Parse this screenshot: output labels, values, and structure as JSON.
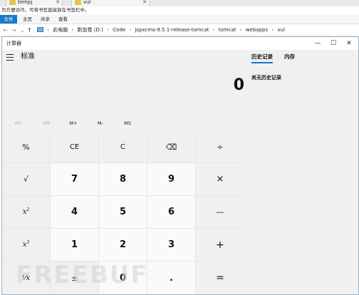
{
  "browser_tabs": [
    {
      "label": "tempj"
    },
    {
      "label": "vul"
    }
  ],
  "bookmark_bar": {
    "text": "为方便访问，可将书签直接放在书签栏中。"
  },
  "ribbon": {
    "file": "文件",
    "tabs": [
      "主页",
      "共享",
      "查看"
    ]
  },
  "address_bar": {
    "nav": {
      "back": "←",
      "forward": "→",
      "recent": "⌄",
      "up": "↑"
    },
    "breadcrumbs": [
      "此电脑",
      "新加卷 (D:)",
      "Code",
      "jspxcms-9.5.1-release-tomcat",
      "tomcat",
      "webapps",
      "vul"
    ],
    "separator": "›"
  },
  "calculator": {
    "title": "计算器",
    "window_controls": {
      "minimize": "—",
      "maximize": "☐",
      "close": "✕"
    },
    "mode": "标准",
    "display_value": "0",
    "memory": [
      {
        "label": "MC",
        "enabled": false
      },
      {
        "label": "MR",
        "enabled": false
      },
      {
        "label": "M+",
        "enabled": true
      },
      {
        "label": "M-",
        "enabled": true
      },
      {
        "label": "MS",
        "enabled": true
      }
    ],
    "keys": {
      "percent": "%",
      "ce": "CE",
      "c": "C",
      "backspace": "⌫",
      "divide": "÷",
      "sqrt": "√",
      "seven": "7",
      "eight": "8",
      "nine": "9",
      "multiply": "×",
      "square_base": "x",
      "square_exp": "2",
      "four": "4",
      "five": "5",
      "six": "6",
      "minus": "—",
      "cube_base": "x",
      "cube_exp": "3",
      "one": "1",
      "two": "2",
      "three": "3",
      "plus": "+",
      "reciprocal": "⅟x",
      "negate": "±",
      "zero": "0",
      "decimal": ".",
      "equals": "="
    },
    "history_tabs": [
      "历史记录",
      "内存"
    ],
    "history_empty": "尚无历史记录"
  },
  "watermark": "FREEBUF",
  "colors": {
    "accent": "#1a73c8",
    "file_tab": "#1979ca"
  }
}
